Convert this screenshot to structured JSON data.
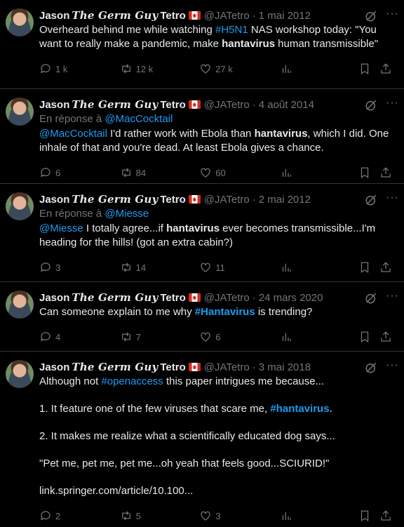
{
  "author": {
    "name_first": "Jason",
    "name_middle": "The Germ Guy",
    "name_last": "Tetro",
    "handle": "@JATetro",
    "dot": "·"
  },
  "icons": {
    "reply": "reply-icon",
    "retweet": "retweet-icon",
    "like": "heart-icon",
    "views": "views-icon",
    "bookmark": "bookmark-icon",
    "share": "share-icon",
    "grok": "grok-icon",
    "more": "more-icon",
    "flag": "canada-flag-icon"
  },
  "colors": {
    "background": "#000000",
    "text": "#e7e9ea",
    "muted": "#71767b",
    "link": "#1d9bf0",
    "divider": "#2f3336"
  },
  "tweets": [
    {
      "date": "1 mai 2012",
      "text_1": "Overheard behind me while watching ",
      "tag_1": "#H5N1",
      "text_2": " NAS workshop today: \"You want to really make a pandemic, make ",
      "bold_1": "hantavirus",
      "text_3": " human transmissible\"",
      "replies": "1 k",
      "retweets": "12 k",
      "likes": "27 k"
    },
    {
      "date": "4 août 2014",
      "reply_prefix": "En réponse à ",
      "reply_handle": "@MacCocktail",
      "mention": "@MacCocktail",
      "text_1": " I'd rather work with Ebola than ",
      "bold_1": "hantavirus",
      "text_2": ", which I did. One inhale of that and you're dead. At least Ebola gives a chance.",
      "replies": "6",
      "retweets": "84",
      "likes": "60"
    },
    {
      "date": "2 mai 2012",
      "reply_prefix": "En réponse à ",
      "reply_handle": "@Miesse",
      "mention": "@Miesse",
      "text_1": " I totally agree...if ",
      "bold_1": "hantavirus",
      "text_2": " ever becomes transmissible...I'm heading for the hills! (got an extra cabin?)",
      "replies": "3",
      "retweets": "14",
      "likes": "11"
    },
    {
      "date": "24 mars 2020",
      "text_1": "Can someone explain to me why ",
      "tag_1": "#Hantavirus",
      "text_2": " is trending?",
      "replies": "4",
      "retweets": "7",
      "likes": "6"
    },
    {
      "date": "3 mai 2018",
      "text_1": "Although not ",
      "tag_1": "#openaccess",
      "text_2": " this paper intrigues me because...",
      "text_3": "1. It feature one of the few viruses that scare me, ",
      "tag_2": "#hantavirus",
      "text_4": ".",
      "text_5": "2. It makes me realize what a scientifically educated dog says...",
      "text_6": "\"Pet me, pet me, pet me...oh yeah that feels good...SCIURID!\"",
      "link": "link.springer.com/article/10.100...",
      "replies": "2",
      "retweets": "5",
      "likes": "3"
    }
  ]
}
